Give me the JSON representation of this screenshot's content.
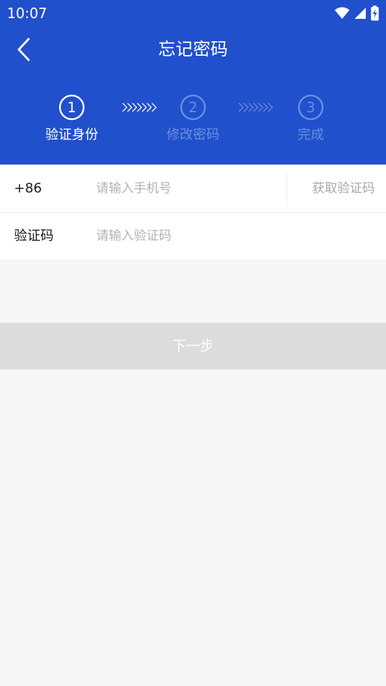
{
  "status_bar": {
    "time": "10:07",
    "icons": [
      "wifi-icon",
      "cell-signal-icon",
      "battery-charging-icon"
    ]
  },
  "nav": {
    "title": "忘记密码",
    "back_icon": "back-chevron-icon"
  },
  "steps": [
    {
      "number": "1",
      "label": "验证身份",
      "active": true
    },
    {
      "number": "2",
      "label": "修改密码",
      "active": false
    },
    {
      "number": "3",
      "label": "完成",
      "active": false
    }
  ],
  "form": {
    "phone": {
      "prefix": "+86",
      "placeholder": "请输入手机号",
      "value": "",
      "get_code_label": "获取验证码"
    },
    "code": {
      "label": "验证码",
      "placeholder": "请输入验证码",
      "value": ""
    }
  },
  "next_button": {
    "label": "下一步",
    "enabled": false
  },
  "colors": {
    "brand": "#2150cc",
    "page_bg": "#f6f6f4",
    "button_disabled": "#dcdcdc",
    "placeholder": "#b2b2b2"
  }
}
